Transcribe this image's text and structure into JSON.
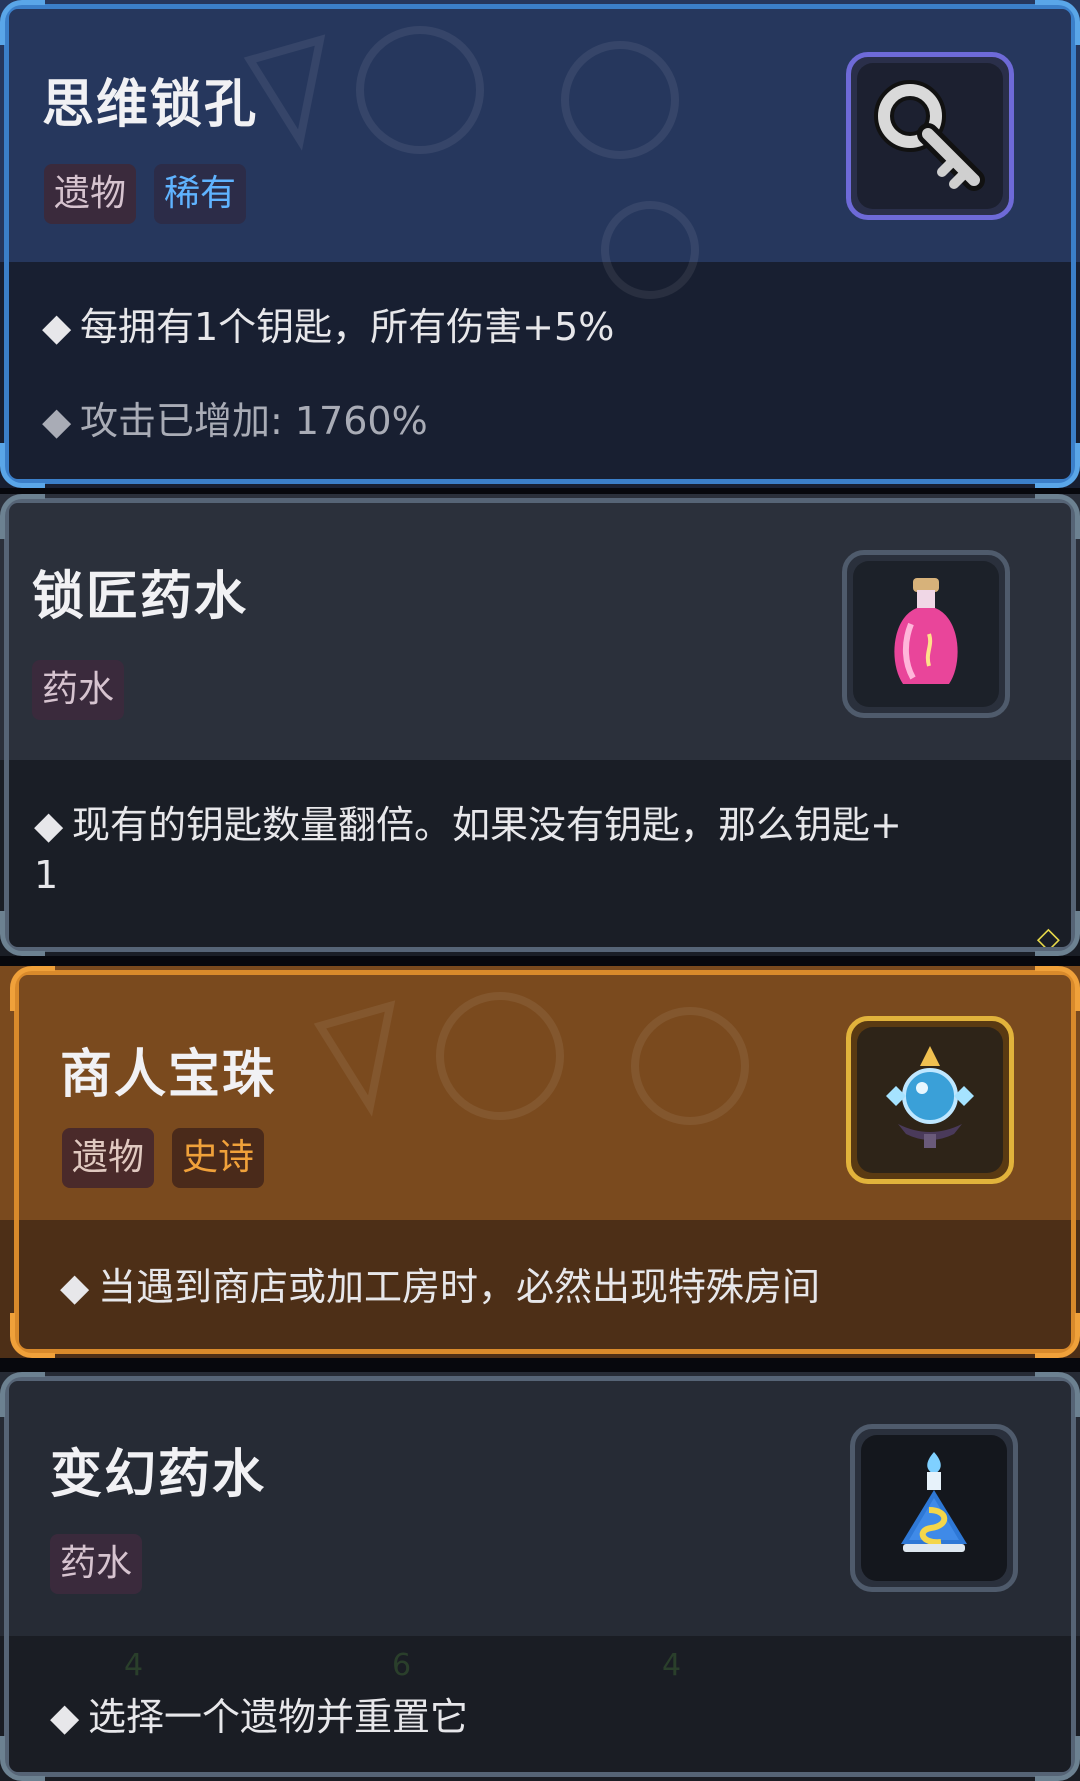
{
  "cards": [
    {
      "title": "思维锁孔",
      "tags": [
        "遗物",
        "稀有"
      ],
      "icon": "key-icon",
      "lines": [
        "每拥有1个钥匙，所有伤害+5%",
        "攻击已增加: 1760%"
      ]
    },
    {
      "title": "锁匠药水",
      "tags": [
        "药水"
      ],
      "icon": "pink-potion-icon",
      "lines": [
        "现有的钥匙数量翻倍。如果没有钥匙，那么钥匙+",
        "1"
      ]
    },
    {
      "title": "商人宝珠",
      "tags": [
        "遗物",
        "史诗"
      ],
      "icon": "orb-icon",
      "lines": [
        "当遇到商店或加工房时，必然出现特殊房间"
      ]
    },
    {
      "title": "变幻药水",
      "tags": [
        "药水"
      ],
      "icon": "blue-potion-icon",
      "lines": [
        "选择一个遗物并重置它"
      ],
      "bg_counters": [
        "4",
        "6",
        "4"
      ]
    }
  ],
  "colors": {
    "rare_blue": "#5fb3ff",
    "epic_orange": "#f0a13a",
    "card1_frame": "#3b7fc9",
    "card3_frame": "#d98a2b",
    "card_gray_frame": "#566476"
  }
}
